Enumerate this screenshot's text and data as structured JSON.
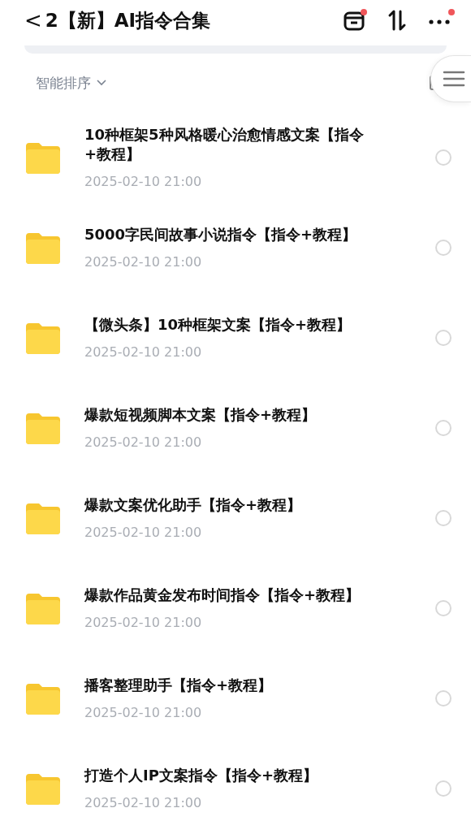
{
  "header": {
    "back": "<",
    "title": "2【新】AI指令合集",
    "actions": [
      {
        "kind": "box",
        "dot": true
      },
      {
        "kind": "sort",
        "dot": false
      },
      {
        "kind": "more",
        "dot": true
      }
    ]
  },
  "sort": {
    "label": "智能排序"
  },
  "files": [
    {
      "name": "10种框架5种风格暖心治愈情感文案【指令+教程】",
      "date": "2025-02-10 21:00",
      "selected": false
    },
    {
      "name": "5000字民间故事小说指令【指令+教程】",
      "date": "2025-02-10 21:00",
      "selected": false
    },
    {
      "name": "【微头条】10种框架文案【指令+教程】",
      "date": "2025-02-10 21:00",
      "selected": false
    },
    {
      "name": "爆款短视频脚本文案【指令+教程】",
      "date": "2025-02-10 21:00",
      "selected": false
    },
    {
      "name": "爆款文案优化助手【指令+教程】",
      "date": "2025-02-10 21:00",
      "selected": false
    },
    {
      "name": "爆款作品黄金发布时间指令【指令+教程】",
      "date": "2025-02-10 21:00",
      "selected": false
    },
    {
      "name": "播客整理助手【指令+教程】",
      "date": "2025-02-10 21:00",
      "selected": false
    },
    {
      "name": "打造个人IP文案指令【指令+教程】",
      "date": "2025-02-10 21:00",
      "selected": false
    }
  ]
}
